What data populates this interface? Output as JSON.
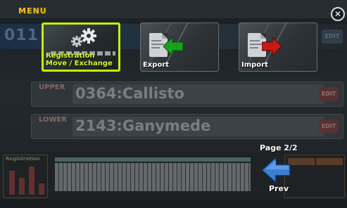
{
  "menu": {
    "title": "MENU",
    "close_symbol": "✕"
  },
  "tiles": [
    {
      "id": "registration-move-exchange",
      "line1": "Registration",
      "line2": "Move / Exchange",
      "icon": "gear-icon",
      "selected": true
    },
    {
      "id": "export",
      "line1": "Export",
      "icon": "export-doc-icon",
      "arrow_color": "#1aa01a"
    },
    {
      "id": "import",
      "line1": "Import",
      "icon": "import-doc-icon",
      "arrow_color": "#c81818"
    }
  ],
  "pagination": {
    "page_text": "Page 2/2",
    "prev_label": "Prev",
    "arrow_color": "#3a7ed0"
  },
  "background": {
    "registration_number": "011",
    "upper_tag": "UPPER",
    "upper_name": "0364:Callisto",
    "lower_tag": "LOWER",
    "lower_name": "2143:Ganymede",
    "edit_label": "EDIT",
    "registration_panel_label": "Registration"
  },
  "colors": {
    "selected_border": "#c8f000",
    "menu_title": "#f0c020"
  }
}
